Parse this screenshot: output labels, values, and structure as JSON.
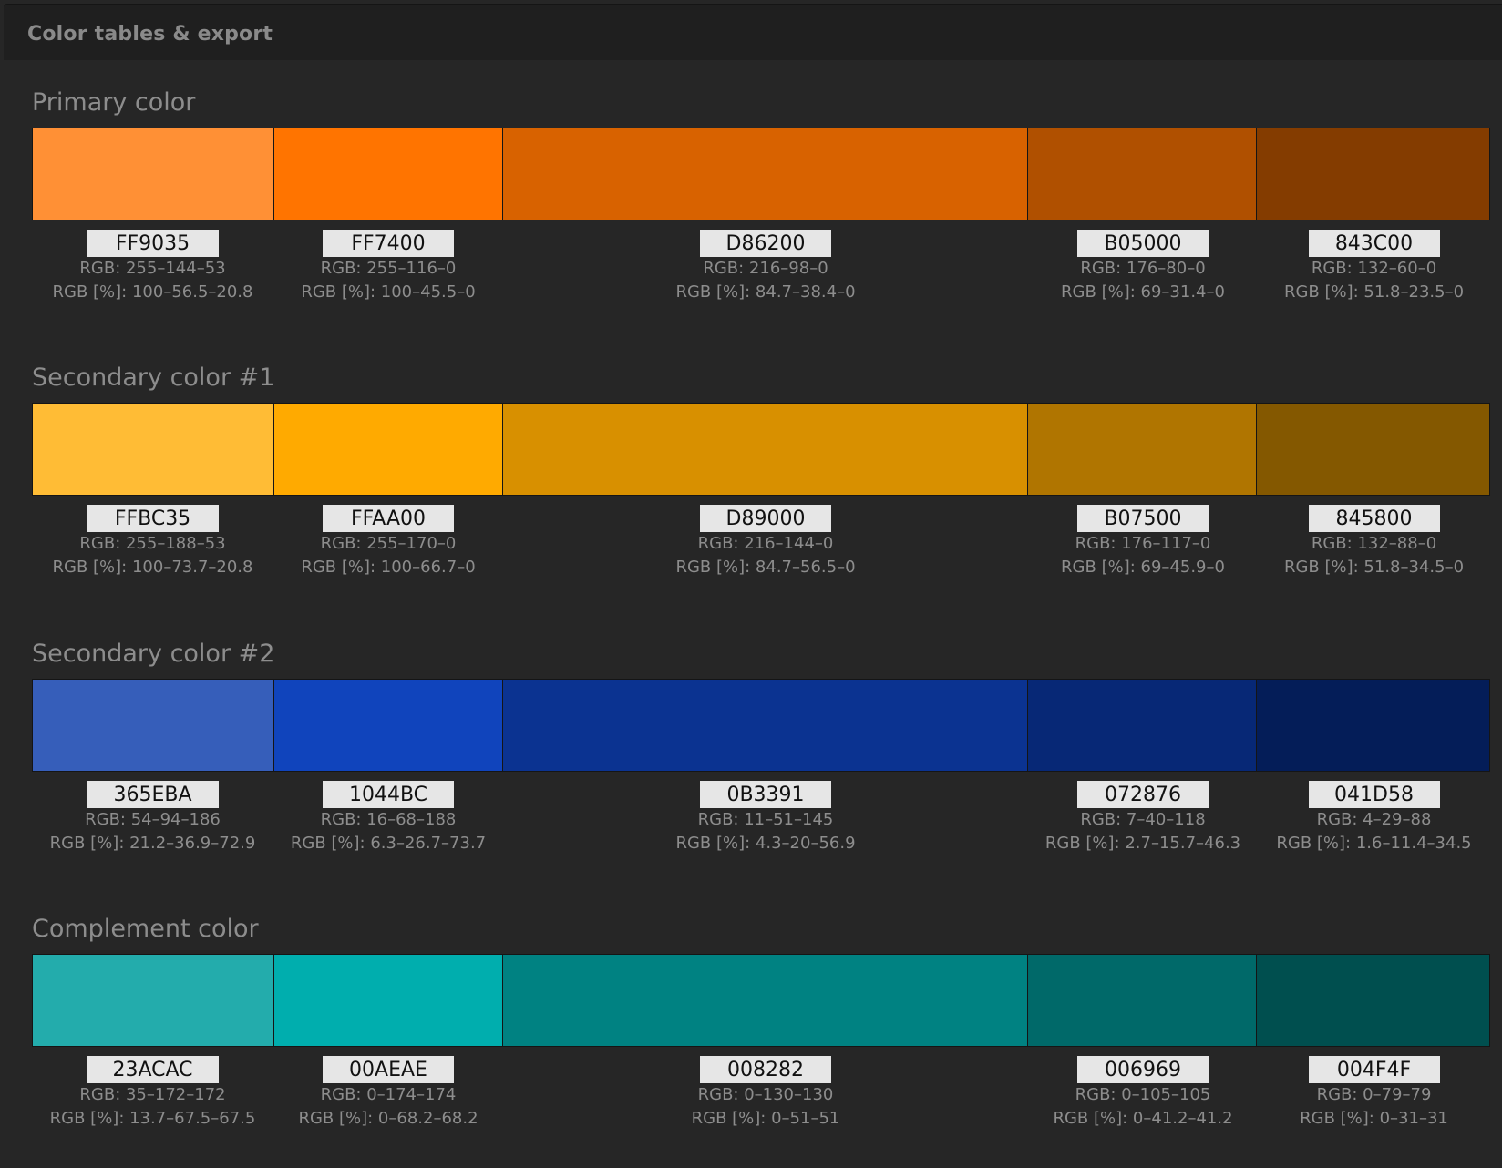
{
  "panel": {
    "title": "Color tables & export"
  },
  "sections": [
    {
      "title": "Primary color",
      "swatches": [
        {
          "hex": "FF9035",
          "color": "#FF9035",
          "rgb": "RGB: 255–144–53",
          "rgb_pct": "RGB [%]: 100–56.5–20.8"
        },
        {
          "hex": "FF7400",
          "color": "#FF7400",
          "rgb": "RGB: 255–116–0",
          "rgb_pct": "RGB [%]: 100–45.5–0"
        },
        {
          "hex": "D86200",
          "color": "#D86200",
          "rgb": "RGB: 216–98–0",
          "rgb_pct": "RGB [%]: 84.7–38.4–0"
        },
        {
          "hex": "B05000",
          "color": "#B05000",
          "rgb": "RGB: 176–80–0",
          "rgb_pct": "RGB [%]: 69–31.4–0"
        },
        {
          "hex": "843C00",
          "color": "#843C00",
          "rgb": "RGB: 132–60–0",
          "rgb_pct": "RGB [%]: 51.8–23.5–0"
        }
      ]
    },
    {
      "title": "Secondary color #1",
      "swatches": [
        {
          "hex": "FFBC35",
          "color": "#FFBC35",
          "rgb": "RGB: 255–188–53",
          "rgb_pct": "RGB [%]: 100–73.7–20.8"
        },
        {
          "hex": "FFAA00",
          "color": "#FFAA00",
          "rgb": "RGB: 255–170–0",
          "rgb_pct": "RGB [%]: 100–66.7–0"
        },
        {
          "hex": "D89000",
          "color": "#D89000",
          "rgb": "RGB: 216–144–0",
          "rgb_pct": "RGB [%]: 84.7–56.5–0"
        },
        {
          "hex": "B07500",
          "color": "#B07500",
          "rgb": "RGB: 176–117–0",
          "rgb_pct": "RGB [%]: 69–45.9–0"
        },
        {
          "hex": "845800",
          "color": "#845800",
          "rgb": "RGB: 132–88–0",
          "rgb_pct": "RGB [%]: 51.8–34.5–0"
        }
      ]
    },
    {
      "title": "Secondary color #2",
      "swatches": [
        {
          "hex": "365EBA",
          "color": "#365EBA",
          "rgb": "RGB: 54–94–186",
          "rgb_pct": "RGB [%]: 21.2–36.9–72.9"
        },
        {
          "hex": "1044BC",
          "color": "#1044BC",
          "rgb": "RGB: 16–68–188",
          "rgb_pct": "RGB [%]: 6.3–26.7–73.7"
        },
        {
          "hex": "0B3391",
          "color": "#0B3391",
          "rgb": "RGB: 11–51–145",
          "rgb_pct": "RGB [%]: 4.3–20–56.9"
        },
        {
          "hex": "072876",
          "color": "#072876",
          "rgb": "RGB: 7–40–118",
          "rgb_pct": "RGB [%]: 2.7–15.7–46.3"
        },
        {
          "hex": "041D58",
          "color": "#041D58",
          "rgb": "RGB: 4–29–88",
          "rgb_pct": "RGB [%]: 1.6–11.4–34.5"
        }
      ]
    },
    {
      "title": "Complement color",
      "swatches": [
        {
          "hex": "23ACAC",
          "color": "#23ACAC",
          "rgb": "RGB: 35–172–172",
          "rgb_pct": "RGB [%]: 13.7–67.5–67.5"
        },
        {
          "hex": "00AEAE",
          "color": "#00AEAE",
          "rgb": "RGB: 0–174–174",
          "rgb_pct": "RGB [%]: 0–68.2–68.2"
        },
        {
          "hex": "008282",
          "color": "#008282",
          "rgb": "RGB: 0–130–130",
          "rgb_pct": "RGB [%]: 0–51–51"
        },
        {
          "hex": "006969",
          "color": "#006969",
          "rgb": "RGB: 0–105–105",
          "rgb_pct": "RGB [%]: 0–41.2–41.2"
        },
        {
          "hex": "004F4F",
          "color": "#004F4F",
          "rgb": "RGB: 0–79–79",
          "rgb_pct": "RGB [%]: 0–31–31"
        }
      ]
    }
  ]
}
